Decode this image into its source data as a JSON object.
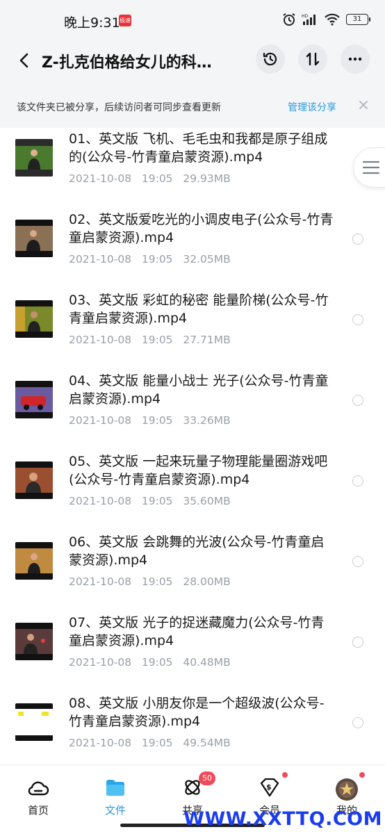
{
  "status_bar": {
    "time": "晚上9:31",
    "badge": "极速",
    "battery": "31"
  },
  "header": {
    "title": "Z-扎克伯格给女儿的科…"
  },
  "share_banner": {
    "text": "该文件夹已被分享，后续访问者可同步查看更新",
    "manage_label": "管理该分享"
  },
  "files": [
    {
      "name": "01、英文版 飞机、毛毛虫和我都是原子组成的(公众号-竹青童启蒙资源).mp4",
      "date": "2021-10-08",
      "time": "19:05",
      "size": "29.93MB"
    },
    {
      "name": "02、英文版爱吃光的小调皮电子(公众号-竹青童启蒙资源).mp4",
      "date": "2021-10-08",
      "time": "19:05",
      "size": "32.05MB"
    },
    {
      "name": "03、英文版 彩虹的秘密 能量阶梯(公众号-竹青童启蒙资源).mp4",
      "date": "2021-10-08",
      "time": "19:05",
      "size": "27.71MB"
    },
    {
      "name": "04、英文版 能量小战士 光子(公众号-竹青童启蒙资源).mp4",
      "date": "2021-10-08",
      "time": "19:05",
      "size": "33.26MB"
    },
    {
      "name": "05、英文版 一起来玩量子物理能量圈游戏吧(公众号-竹青童启蒙资源).mp4",
      "date": "2021-10-08",
      "time": "19:05",
      "size": "35.60MB"
    },
    {
      "name": "06、英文版 会跳舞的光波(公众号-竹青童启蒙资源).mp4",
      "date": "2021-10-08",
      "time": "19:05",
      "size": "28.00MB"
    },
    {
      "name": "07、英文版 光子的捉迷藏魔力(公众号-竹青童启蒙资源).mp4",
      "date": "2021-10-08",
      "time": "19:05",
      "size": "40.48MB"
    },
    {
      "name": "08、英文版 小朋友你是一个超级波(公众号-竹青童启蒙资源).mp4",
      "date": "2021-10-08",
      "time": "19:05",
      "size": "49.54MB"
    }
  ],
  "nav": {
    "home": "首页",
    "files": "文件",
    "share": "共享",
    "share_count": "50",
    "vip": "会员",
    "mine": "我的"
  },
  "watermark": "WWW.XXTTQ.COM",
  "colors": {
    "accent": "#2a9ae0",
    "badge": "#f04a5a",
    "watermark": "#1c3cf0"
  }
}
